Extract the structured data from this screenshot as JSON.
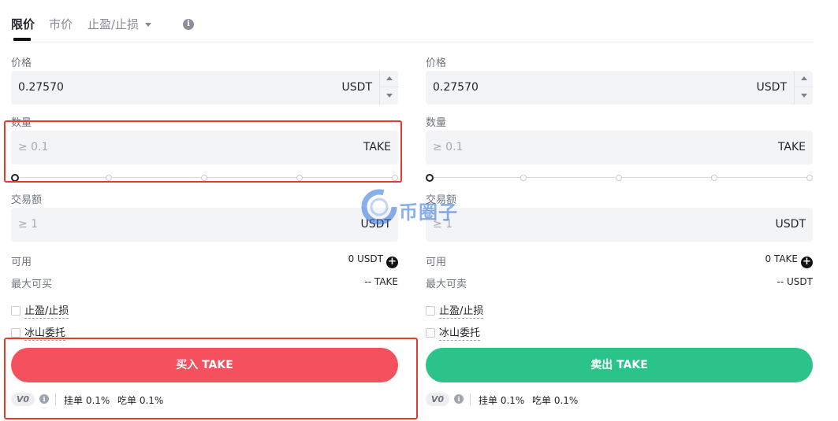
{
  "tabs": [
    {
      "label": "限价",
      "active": true
    },
    {
      "label": "市价",
      "active": false
    },
    {
      "label": "止盈/止损",
      "active": false,
      "dropdown": true
    }
  ],
  "info_icon": "i",
  "buy": {
    "price_label": "价格",
    "price_value": "0.27570",
    "price_unit": "USDT",
    "qty_label": "数量",
    "qty_placeholder": "≥ 0.1",
    "qty_unit": "TAKE",
    "slider_percent": 0,
    "amount_label": "交易额",
    "amount_placeholder": "≥ 1",
    "amount_unit": "USDT",
    "available_label": "可用",
    "available_value": "0 USDT",
    "max_label": "最大可买",
    "max_value": "-- TAKE",
    "tpsl_label": "止盈/止损",
    "iceberg_label": "冰山委托",
    "action_label": "买入 TAKE",
    "action_color": "#f4505e"
  },
  "sell": {
    "price_label": "价格",
    "price_value": "0.27570",
    "price_unit": "USDT",
    "qty_label": "数量",
    "qty_placeholder": "≥ 0.1",
    "qty_unit": "TAKE",
    "slider_percent": 0,
    "amount_label": "交易额",
    "amount_placeholder": "≥ 1",
    "amount_unit": "USDT",
    "available_label": "可用",
    "available_value": "0 TAKE",
    "max_label": "最大可卖",
    "max_value": "-- USDT",
    "tpsl_label": "止盈/止损",
    "iceberg_label": "冰山委托",
    "action_label": "卖出 TAKE",
    "action_color": "#2cc38a"
  },
  "fees": {
    "vip_level": "V0",
    "maker": "挂单 0.1%",
    "taker": "吃单 0.1%"
  },
  "icons": {
    "plus": "+",
    "info": "i"
  },
  "watermark": "币圈子",
  "colors": {
    "buy": "#f4505e",
    "sell": "#2cc38a",
    "highlight": "#e53a2e"
  }
}
